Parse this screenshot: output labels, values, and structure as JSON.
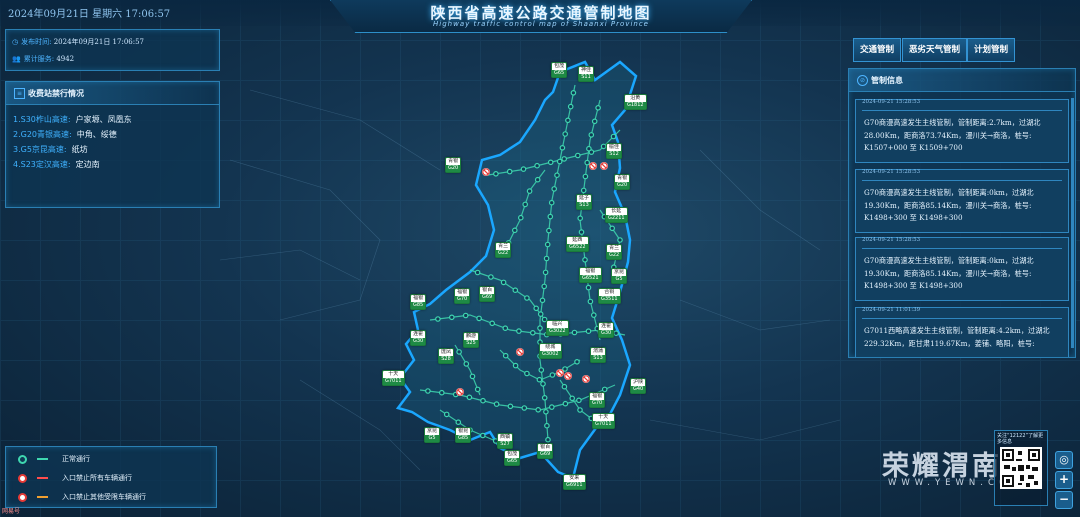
{
  "header": {
    "datetime": "2024年09月21日 星期六  17:06:57",
    "title": "陕西省高速公路交通管制地图",
    "subtitle": "Highway traffic control map of Shaanxi Province"
  },
  "info": {
    "publish_label": "发布时间:",
    "publish_value": "2024年09月21日 17:06:57",
    "service_label": "累计服务:",
    "service_value": "4942"
  },
  "toll_panel": {
    "title": "收费站禁行情况",
    "items": [
      {
        "road": "1.S30柞山高速:",
        "stations": "户家塬、凤凰东"
      },
      {
        "road": "2.G20青银高速:",
        "stations": "中角、绥德"
      },
      {
        "road": "3.G5京昆高速:",
        "stations": "纸坊"
      },
      {
        "road": "4.S23定汉高速:",
        "stations": "定边南"
      }
    ]
  },
  "tabs": [
    "交通管制",
    "恶劣天气管制",
    "计划管制"
  ],
  "control_panel": {
    "title": "管制信息",
    "cards": [
      {
        "time": "2024-09-21 15:28:53",
        "text": "G70商漫高速发生主线管制，管制距离:2.7km，过湖北28.00Km，距商洛73.74Km，漫川关→商洛，桩号: K1507+000 至 K1509+700"
      },
      {
        "time": "2024-09-21 15:28:53",
        "text": "G70商漫高速发生主线管制，管制距离:0km，过湖北19.30Km，距商洛85.14Km，漫川关→商洛，桩号: K1498+300 至 K1498+300"
      },
      {
        "time": "2024-09-21 15:28:53",
        "text": "G70商漫高速发生主线管制，管制距离:0km，过湖北19.30Km，距商洛85.14Km，漫川关→商洛，桩号: K1498+300 至 K1498+300"
      },
      {
        "time": "2024-09-21 11:01:39",
        "text": "G7011西略高速发生主线管制，管制距离:4.2km，过湖北229.32Km，距甘肃119.67Km，姜铺、略阳，桩号:"
      }
    ]
  },
  "legend": [
    {
      "icon": "normal-traffic-icon",
      "label": "正常通行",
      "color": "#3fd7b0"
    },
    {
      "icon": "no-entry-all-vehicles-icon",
      "label": "入口禁止所有车辆通行",
      "color": "#ff4d4d"
    },
    {
      "icon": "no-entry-other-vehicles-icon",
      "label": "入口禁止其他受限车辆通行",
      "color": "#f0a030"
    }
  ],
  "map": {
    "highway_color": "#3fd7b0",
    "outline_color": "#1aa7ff",
    "badges": [
      {
        "top": "包茂",
        "code": "G65"
      },
      {
        "top": "神佳",
        "code": "S11"
      },
      {
        "top": "沿黄",
        "code": "G1812"
      },
      {
        "top": "榆佳",
        "code": "S12"
      },
      {
        "top": "青银",
        "code": "G20"
      },
      {
        "top": "青银",
        "code": "G20"
      },
      {
        "top": "延子",
        "code": "S13"
      },
      {
        "top": "长延",
        "code": "G2211"
      },
      {
        "top": "青兰",
        "code": "G22"
      },
      {
        "top": "延西",
        "code": "G6522"
      },
      {
        "top": "青兰",
        "code": "G22"
      },
      {
        "top": "福银",
        "code": "G6521"
      },
      {
        "top": "京昆",
        "code": "G5"
      },
      {
        "top": "银百",
        "code": "G69"
      },
      {
        "top": "福银",
        "code": "G70"
      },
      {
        "top": "合铜",
        "code": "G3511"
      },
      {
        "top": "福银",
        "code": "G85"
      },
      {
        "top": "临兴",
        "code": "G3022"
      },
      {
        "top": "连霍",
        "code": "G30"
      },
      {
        "top": "连霍",
        "code": "G30"
      },
      {
        "top": "麟游",
        "code": "S25"
      },
      {
        "top": "绕城",
        "code": "G3002"
      },
      {
        "top": "渭蒲",
        "code": "S13"
      },
      {
        "top": "庞凤",
        "code": "S28"
      },
      {
        "top": "十天",
        "code": "G7011"
      },
      {
        "top": "沪陕",
        "code": "G40"
      },
      {
        "top": "福银",
        "code": "G70"
      },
      {
        "top": "十天",
        "code": "G7011"
      },
      {
        "top": "京昆",
        "code": "G5"
      },
      {
        "top": "银昆",
        "code": "G85"
      },
      {
        "top": "西镇",
        "code": "S27"
      },
      {
        "top": "包茂",
        "code": "G65"
      },
      {
        "top": "银百",
        "code": "G69"
      },
      {
        "top": "安来",
        "code": "G6911"
      }
    ]
  },
  "watermark": {
    "text": "荣耀渭南",
    "url": "WWW.YEWN.COM"
  },
  "qr": {
    "caption": "关注“12122”了解更多信息"
  },
  "zoom": {
    "locate": "◎",
    "plus": "+",
    "minus": "−"
  },
  "corner_logo": "网易号"
}
